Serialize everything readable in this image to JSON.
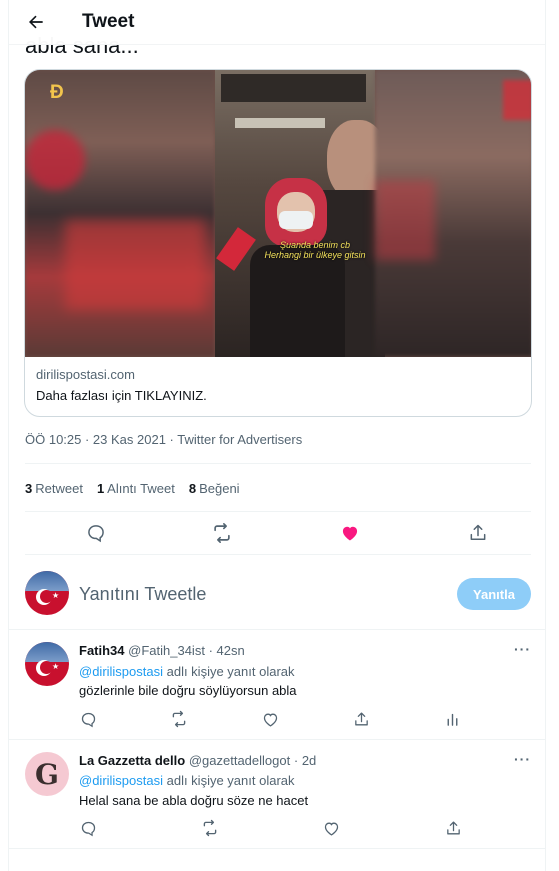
{
  "header": {
    "title": "Tweet",
    "back_icon": "arrow-left-icon"
  },
  "tweet": {
    "text_cut": "abla sana...",
    "card": {
      "domain": "dirilispostasi.com",
      "text": "Daha fazlası için TIKLAYINIZ.",
      "image": {
        "subtitle_line1": "Şuanda benim cb",
        "subtitle_line2": "Herhangi bir ülkeye gitsin"
      }
    },
    "timestamp": "ÖÖ 10:25 · 23 Kas 2021 · Twitter for Advertisers",
    "stats": {
      "retweets": "3",
      "retweets_label": "Retweet",
      "quotes": "1",
      "quotes_label": "Alıntı Tweet",
      "likes": "8",
      "likes_label": "Beğeni"
    },
    "liked": true,
    "colors": {
      "like": "#f91880",
      "link": "#1d9bf0",
      "muted": "#536471"
    }
  },
  "reply_compose": {
    "placeholder": "Yanıtını Tweetle",
    "button": "Yanıtla"
  },
  "replies": [
    {
      "name": "Fatih34",
      "handle": "@Fatih_34ist",
      "time": "42sn",
      "reply_to_mention": "@dirilispostasi",
      "reply_to_suffix": " adlı kişiye yanıt olarak",
      "text": "gözlerinle bile doğru söylüyorsun abla",
      "avatar": "turkish-flag"
    },
    {
      "name": "La Gazzetta dello",
      "handle": "@gazettadellogot",
      "time": "2d",
      "reply_to_mention": "@dirilispostasi",
      "reply_to_suffix": " adlı kişiye yanıt olarak",
      "text": "Helal sana be abla doğru söze ne hacet",
      "avatar": "G"
    }
  ]
}
